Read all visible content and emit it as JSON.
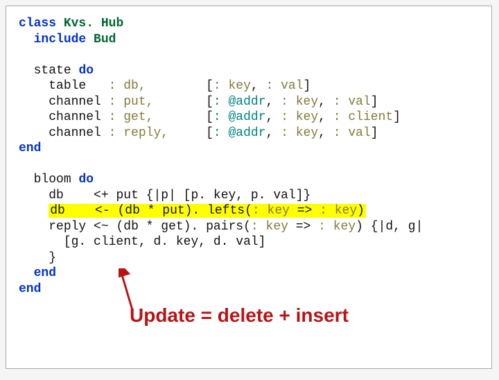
{
  "code": {
    "classDecl": {
      "kw": "class",
      "name": "Kvs. Hub"
    },
    "includeDecl": {
      "kw": "include",
      "mod": "Bud"
    },
    "stateBlock": {
      "stateKw": "state",
      "doKw": "do",
      "rows": [
        {
          "kind": "table",
          "name": ": db,",
          "schemaL": "[",
          "k1": ": key",
          "sep1": ", ",
          "k2": ": val",
          "sep2": "",
          "k3": "",
          "close": "]"
        },
        {
          "kind": "channel",
          "name": ": put,",
          "schemaL": "[",
          "k1": ": @addr",
          "sep1": ", ",
          "k2": ": key",
          "sep2": ", ",
          "k3": ": val",
          "close": "]"
        },
        {
          "kind": "channel",
          "name": ": get,",
          "schemaL": "[",
          "k1": ": @addr",
          "sep1": ", ",
          "k2": ": key",
          "sep2": ", ",
          "k3": ": client",
          "close": "]"
        },
        {
          "kind": "channel",
          "name": ": reply,",
          "schemaL": "[",
          "k1": ": @addr",
          "sep1": ", ",
          "k2": ": key",
          "sep2": ", ",
          "k3": ": val",
          "close": "]"
        }
      ],
      "endKw": "end"
    },
    "bloomBlock": {
      "bloomKw": "bloom",
      "doKw": "do",
      "line1": {
        "lhs": "db",
        "op": "<+",
        "rhs_a": "put {|p| [p",
        "rhs_b": ". key, p",
        "rhs_c": ". val]}"
      },
      "line2": {
        "lhs": "db",
        "op": "<-",
        "rhs_a": "(db * put)",
        "rhs_b": ". lefts(",
        "rhs_c": ": key",
        "rhs_d": " => ",
        "rhs_e": ": key",
        "rhs_f": ")"
      },
      "line3": {
        "lhs": "reply",
        "op": "<~",
        "rhs_a": "(db * get)",
        "rhs_b": ". pairs(",
        "rhs_c": ": key",
        "rhs_d": " => ",
        "rhs_e": ": key",
        "rhs_f": ") {|d, g|"
      },
      "line3b": {
        "a": "[g",
        "b": ". client, d",
        "c": ". key, d",
        "d": ". val]"
      },
      "closeBrace": "}",
      "end1": "end",
      "end2": "end"
    }
  },
  "callout": "Update = delete + insert"
}
